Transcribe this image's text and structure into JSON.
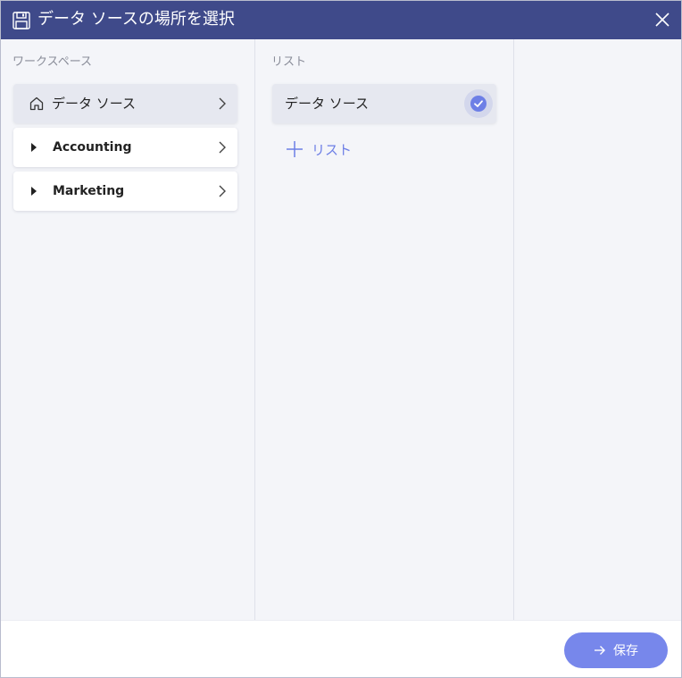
{
  "dialog": {
    "title": "データ ソースの場所を選択",
    "close_icon": "close-icon",
    "title_icon": "save-disk-icon"
  },
  "workspace_column": {
    "header": "ワークスペース",
    "items": [
      {
        "label": "データ ソース",
        "icon": "home-icon",
        "selected": true
      },
      {
        "label": "Accounting",
        "icon": "caret-right-icon",
        "selected": false
      },
      {
        "label": "Marketing",
        "icon": "caret-right-icon",
        "selected": false
      }
    ]
  },
  "list_column": {
    "header": "リスト",
    "items": [
      {
        "label": "データ ソース",
        "checked": true
      }
    ],
    "add_label": "リスト"
  },
  "footer": {
    "save_label": "保存"
  },
  "colors": {
    "titlebar": "#3f4a8a",
    "accent": "#6d7fe6",
    "save_button": "#7787eb",
    "panel_bg": "#f4f5f9"
  }
}
